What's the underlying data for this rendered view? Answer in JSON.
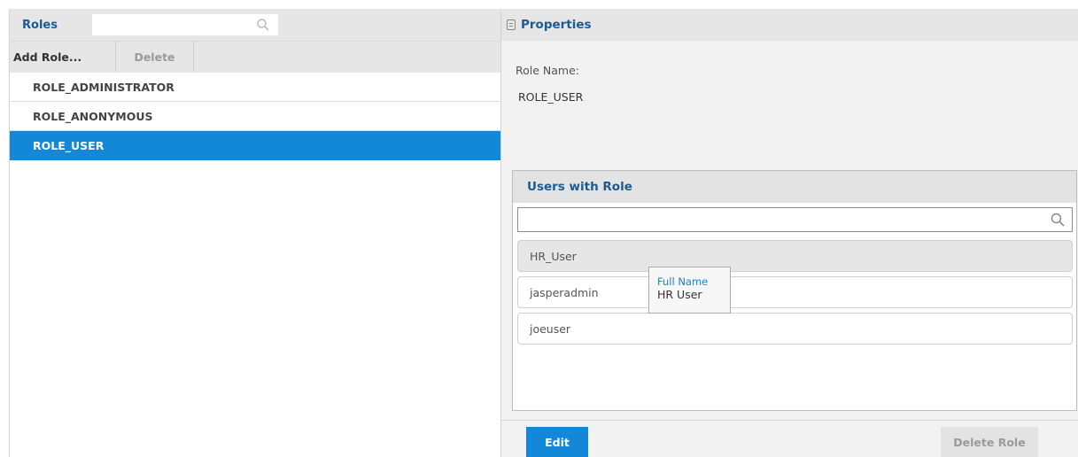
{
  "roles_panel": {
    "title": "Roles",
    "search": {
      "value": "",
      "placeholder": ""
    },
    "toolbar": {
      "add_label": "Add Role...",
      "delete_label": "Delete"
    },
    "items": [
      {
        "label": "ROLE_ADMINISTRATOR",
        "selected": false
      },
      {
        "label": "ROLE_ANONYMOUS",
        "selected": false
      },
      {
        "label": "ROLE_USER",
        "selected": true
      }
    ]
  },
  "properties_panel": {
    "title": "Properties",
    "role_name_label": "Role Name:",
    "role_name_value": "ROLE_USER",
    "users_section": {
      "title": "Users with Role",
      "search": {
        "value": "",
        "placeholder": ""
      },
      "users": [
        {
          "name": "HR_User",
          "hovered": true
        },
        {
          "name": "jasperadmin",
          "hovered": false
        },
        {
          "name": "joeuser",
          "hovered": false
        }
      ],
      "tooltip": {
        "label": "Full Name",
        "value": "HR User"
      }
    },
    "footer": {
      "edit_label": "Edit",
      "delete_role_label": "Delete Role"
    }
  },
  "colors": {
    "accent_blue": "#1388d8",
    "title_blue": "#1c5b91",
    "header_gray": "#e6e6e6",
    "panel_bg": "#f2f2f2"
  }
}
